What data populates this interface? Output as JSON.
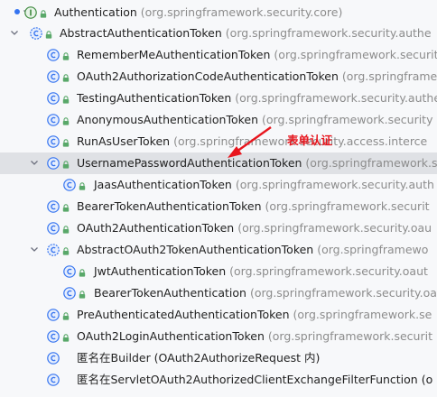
{
  "tree": {
    "root": {
      "name": "Authentication",
      "pkg": "(org.springframework.security.core)"
    },
    "abstract_auth_token": {
      "name": "AbstractAuthenticationToken",
      "pkg": "(org.springframework.security.authe"
    },
    "remember_me": {
      "name": "RememberMeAuthenticationToken",
      "pkg": "(org.springframework.security"
    },
    "oauth2_authz_code": {
      "name": "OAuth2AuthorizationCodeAuthenticationToken",
      "pkg": "(org.springframe"
    },
    "testing": {
      "name": "TestingAuthenticationToken",
      "pkg": "(org.springframework.security.authe"
    },
    "anonymous": {
      "name": "AnonymousAuthenticationToken",
      "pkg": "(org.springframework.security"
    },
    "run_as_user": {
      "name": "RunAsUserToken",
      "pkg": "(org.springframework.security.access.interce"
    },
    "username_password": {
      "name": "UsernamePasswordAuthenticationToken",
      "pkg": "(org.springframework.s"
    },
    "jaas": {
      "name": "JaasAuthenticationToken",
      "pkg": "(org.springframework.security.auth"
    },
    "bearer_token_auth_token": {
      "name": "BearerTokenAuthenticationToken",
      "pkg": "(org.springframework.securit"
    },
    "oauth2_auth_token": {
      "name": "OAuth2AuthenticationToken",
      "pkg": "(org.springframework.security.oau"
    },
    "abstract_oauth2_token": {
      "name": "AbstractOAuth2TokenAuthenticationToken",
      "pkg": "(org.springframewo"
    },
    "jwt": {
      "name": "JwtAuthenticationToken",
      "pkg": "(org.springframework.security.oaut"
    },
    "bearer_token_auth": {
      "name": "BearerTokenAuthentication",
      "pkg": "(org.springframework.security.oa"
    },
    "pre_authenticated": {
      "name": "PreAuthenticatedAuthenticationToken",
      "pkg": "(org.springframework.se"
    },
    "oauth2_login": {
      "name": "OAuth2LoginAuthenticationToken",
      "pkg": "(org.springframework.securit"
    },
    "anon_builder": {
      "name": "匿名在Builder (OAuth2AuthorizeRequest 内)"
    },
    "anon_servlet": {
      "name": "匿名在ServletOAuth2AuthorizedClientExchangeFilterFunction (o"
    }
  },
  "annotation": {
    "text": "表单认证",
    "color": "#e8161e"
  },
  "colors": {
    "accent": "#3574f0",
    "interface_green": "#3e8a3e",
    "selected_row": "#dfe1e5",
    "lock_green": "#59a869"
  }
}
